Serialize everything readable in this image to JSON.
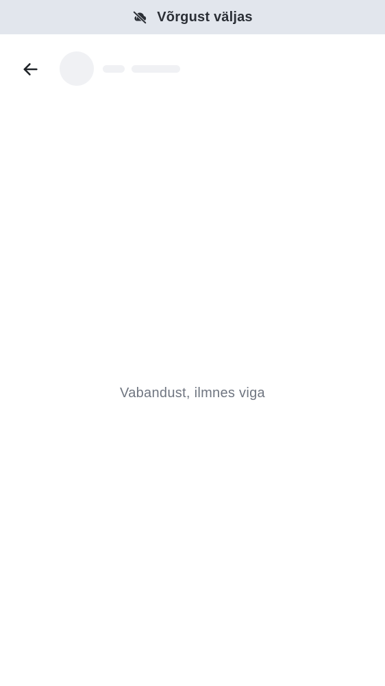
{
  "offline_banner": {
    "text": "Võrgust väljas",
    "icon": "cloud-off-icon",
    "background": "#e2e6ed"
  },
  "header": {
    "back_icon": "arrow-back-icon"
  },
  "main": {
    "error_text": "Vabandust, ilmnes viga"
  },
  "colors": {
    "text_primary": "#2b2f36",
    "text_secondary": "#6f7580",
    "skeleton": "#f0f1f4"
  }
}
